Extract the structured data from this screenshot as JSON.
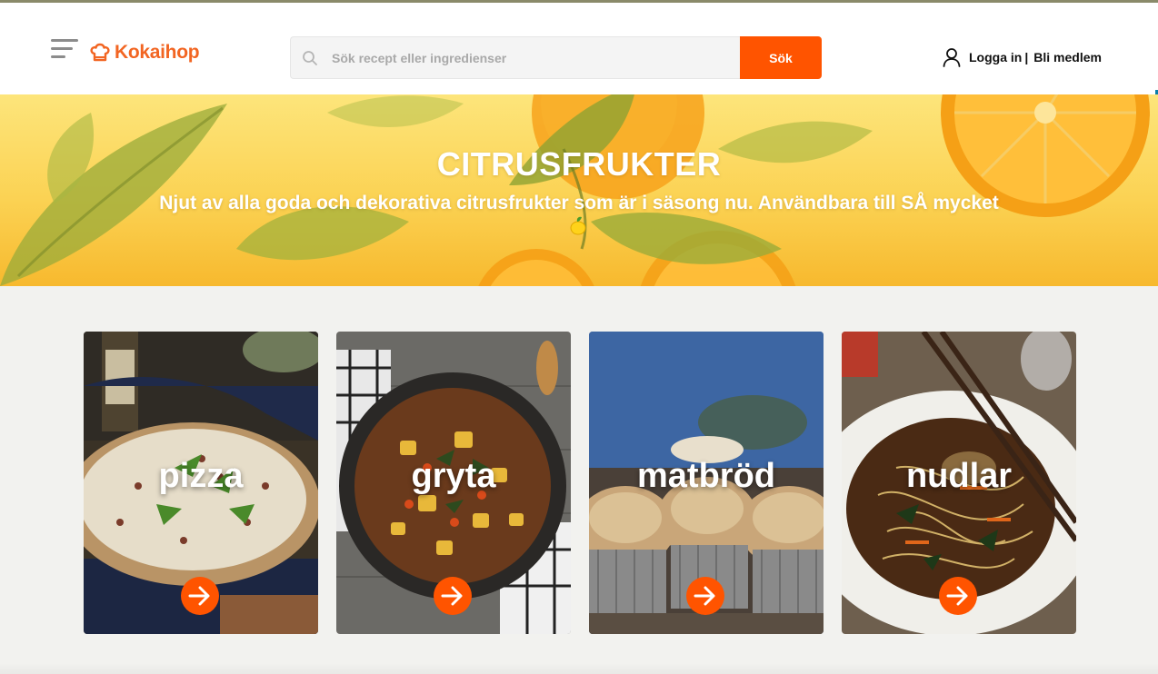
{
  "header": {
    "brand": "Kokaihop",
    "search_placeholder": "Sök recept eller ingredienser",
    "search_button": "Sök",
    "login_label": "Logga in",
    "separator": "|",
    "signup_label": "Bli medlem",
    "accent_color": "#ff5400"
  },
  "hero": {
    "title": "CITRUSFRUKTER",
    "subtitle": "Njut av alla goda och dekorativa citrusfrukter som är i säsong nu. Användbara till SÅ mycket"
  },
  "categories": [
    {
      "label": "pizza",
      "icon": "arrow-right-icon"
    },
    {
      "label": "gryta",
      "icon": "arrow-right-icon"
    },
    {
      "label": "matbröd",
      "icon": "arrow-right-icon"
    },
    {
      "label": "nudlar",
      "icon": "arrow-right-icon"
    }
  ]
}
